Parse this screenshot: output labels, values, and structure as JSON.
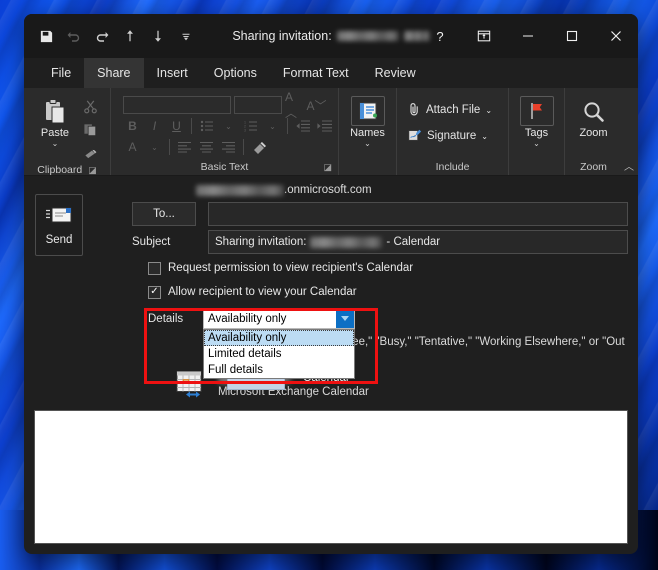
{
  "window": {
    "title_prefix": "Sharing invitation:",
    "title_redacted": true
  },
  "quick_access": [
    {
      "name": "save-icon",
      "label": "Save",
      "enabled": true
    },
    {
      "name": "undo-icon",
      "label": "Undo",
      "enabled": false
    },
    {
      "name": "redo-icon",
      "label": "Redo",
      "enabled": true
    },
    {
      "name": "previous-item-icon",
      "label": "Previous Item",
      "enabled": true
    },
    {
      "name": "next-item-icon",
      "label": "Next Item",
      "enabled": true
    },
    {
      "name": "customize-quick-access-toolbar-icon",
      "label": "Customize Quick Access Toolbar",
      "enabled": true
    }
  ],
  "window_buttons": [
    {
      "name": "help-button",
      "glyph": "?",
      "label": "Help"
    },
    {
      "name": "ribbon-display-options-button",
      "glyph": "⊡",
      "label": "Ribbon Display Options"
    },
    {
      "name": "minimize-button",
      "glyph": "—",
      "label": "Minimize"
    },
    {
      "name": "maximize-button",
      "glyph": "☐",
      "label": "Maximize"
    },
    {
      "name": "close-button",
      "glyph": "✕",
      "label": "Close"
    }
  ],
  "tabs": [
    {
      "label": "File",
      "active": false
    },
    {
      "label": "Share",
      "active": true
    },
    {
      "label": "Insert",
      "active": false
    },
    {
      "label": "Options",
      "active": false
    },
    {
      "label": "Format Text",
      "active": false
    },
    {
      "label": "Review",
      "active": false
    }
  ],
  "ribbon": {
    "groups": [
      {
        "label": "Clipboard",
        "has_launcher": true
      },
      {
        "label": "Basic Text",
        "has_launcher": true
      },
      {
        "label": "Names",
        "has_launcher": false
      },
      {
        "label": "Include",
        "has_launcher": false
      },
      {
        "label": "Tags",
        "has_launcher": false
      },
      {
        "label": "Zoom",
        "has_launcher": false
      }
    ],
    "clipboard": {
      "paste_label": "Paste",
      "cut_label": "Cut",
      "copy_label": "Copy",
      "format_painter_label": "Format Painter"
    },
    "basic_text": {
      "font_name": "",
      "font_size": "",
      "grow_font_label": "A",
      "shrink_font_label": "A",
      "bold_label": "B",
      "italic_label": "I",
      "underline_label": "U",
      "text_color_label": "A",
      "enabled": false
    },
    "names_label": "Names",
    "include": {
      "attach_file_label": "Attach File",
      "signature_label": "Signature"
    },
    "tags_label": "Tags",
    "zoom_label": "Zoom",
    "collapse_label": "Collapse the Ribbon"
  },
  "header": {
    "send_label": "Send",
    "from_address_suffix": ".onmicrosoft.com",
    "to_button_label": "To...",
    "to_value": "",
    "subject_label": "Subject",
    "subject_prefix": "Sharing invitation:",
    "subject_suffix": "- Calendar",
    "request_permission": {
      "label": "Request permission to view recipient's Calendar",
      "checked": false
    },
    "allow_recipient": {
      "label": "Allow recipient to view your Calendar",
      "checked": true
    },
    "details": {
      "label": "Details",
      "selected_value": "Availability only",
      "expanded": true,
      "options": [
        {
          "label": "Availability only",
          "selected": true
        },
        {
          "label": "Limited details",
          "selected": false
        },
        {
          "label": "Full details",
          "selected": false
        }
      ],
      "description_visible_fragment": "wn as \"Free,\" \"Busy,\" \"Tentative,\" \"Working Elsewhere,\" or \"Out"
    },
    "calendar": {
      "name_suffix": "- Calendar",
      "account_type": "Microsoft Exchange Calendar"
    }
  },
  "body": {
    "content": ""
  },
  "colors": {
    "accent_blue": "#0c6fc4",
    "highlight_red": "#ee1111",
    "selection_blue": "#bcdcf4",
    "window_bg": "#1f1f1f",
    "ribbon_bg": "#2b2b2b"
  }
}
